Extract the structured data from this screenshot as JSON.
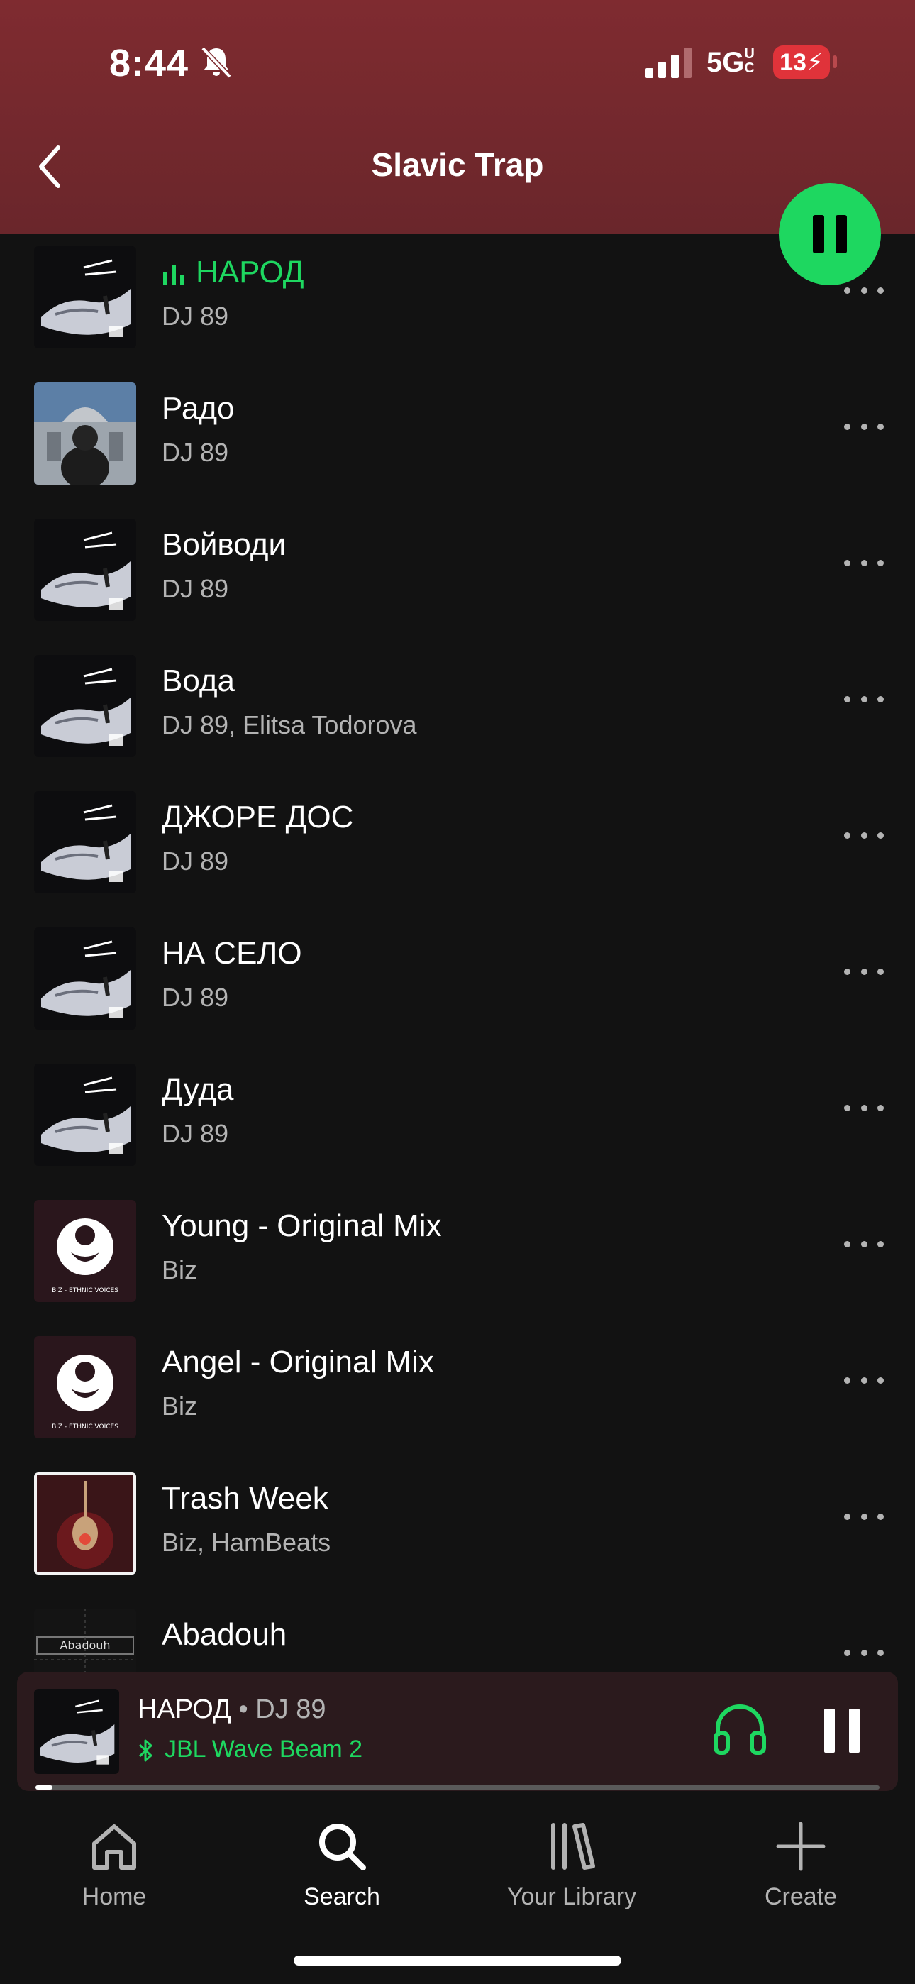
{
  "status_bar": {
    "time": "8:44",
    "network": "5G",
    "network_suffix": "UC",
    "battery": "13"
  },
  "header": {
    "title": "Slavic Trap",
    "back_icon": "chevron-left-icon"
  },
  "play_button": {
    "state": "playing",
    "icon": "pause-icon",
    "color": "#1ed760"
  },
  "tracks": [
    {
      "title": "НАРОД",
      "artist": "DJ 89",
      "playing": true,
      "cover": "balkan-trap"
    },
    {
      "title": "Радо",
      "artist": "DJ 89",
      "playing": false,
      "cover": "cathedral"
    },
    {
      "title": "Войводи",
      "artist": "DJ 89",
      "playing": false,
      "cover": "balkan-trap"
    },
    {
      "title": "Вода",
      "artist": "DJ 89, Elitsa Todorova",
      "playing": false,
      "cover": "balkan-trap"
    },
    {
      "title": "ДЖОРЕ ДОС",
      "artist": "DJ 89",
      "playing": false,
      "cover": "balkan-trap"
    },
    {
      "title": "НА СЕЛО",
      "artist": "DJ 89",
      "playing": false,
      "cover": "balkan-trap"
    },
    {
      "title": "Дуда",
      "artist": "DJ 89",
      "playing": false,
      "cover": "balkan-trap"
    },
    {
      "title": "Young - Original Mix",
      "artist": "Biz",
      "playing": false,
      "cover": "ethnic-voices"
    },
    {
      "title": "Angel - Original Mix",
      "artist": "Biz",
      "playing": false,
      "cover": "ethnic-voices"
    },
    {
      "title": "Trash Week",
      "artist": "Biz, HamBeats",
      "playing": false,
      "cover": "trash-week"
    },
    {
      "title": "Abadouh",
      "artist": "",
      "playing": false,
      "cover": "abadouh"
    }
  ],
  "cover_texts": {
    "ethnic_voices": "BIZ - ETHNIC VOICES",
    "abadouh": "Abadouh"
  },
  "mini_player": {
    "title": "НАРОД",
    "separator": " • ",
    "artist": "DJ 89",
    "device": "JBL Wave Beam 2",
    "progress": 0.02
  },
  "nav": [
    {
      "label": "Home",
      "icon": "home-icon",
      "active": false
    },
    {
      "label": "Search",
      "icon": "search-icon",
      "active": true
    },
    {
      "label": "Your Library",
      "icon": "library-icon",
      "active": false
    },
    {
      "label": "Create",
      "icon": "plus-icon",
      "active": false
    }
  ],
  "colors": {
    "accent": "#1ed760",
    "header": "#7f2b30",
    "background": "#121212"
  }
}
